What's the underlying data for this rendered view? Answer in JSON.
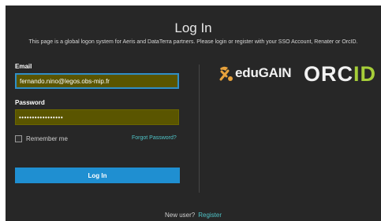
{
  "header": {
    "title": "Log In",
    "subtitle": "This page is a global logon system for Aeris and DataTerra partners. Please login or register with your SSO Account, Renater or OrcID."
  },
  "form": {
    "email_label": "Email",
    "email_value": "fernando.nino@legos.obs-mip.fr",
    "password_label": "Password",
    "password_value": "•••••••••••••••••",
    "remember_label": "Remember me",
    "forgot_label": "Forgot Password?",
    "login_button": "Log In"
  },
  "providers": {
    "edugain_label": "eduGAIN",
    "orcid_prefix": "ORC",
    "orcid_suffix": "ID"
  },
  "footer": {
    "new_user_label": "New user?",
    "register_label": "Register"
  },
  "colors": {
    "background": "#272727",
    "input_fill": "#5a5500",
    "focus_border": "#2f8fc8",
    "button": "#1f8fd1",
    "link": "#4fc3c7",
    "orcid_green": "#a6ce39",
    "edugain_orange": "#e8a23c"
  }
}
